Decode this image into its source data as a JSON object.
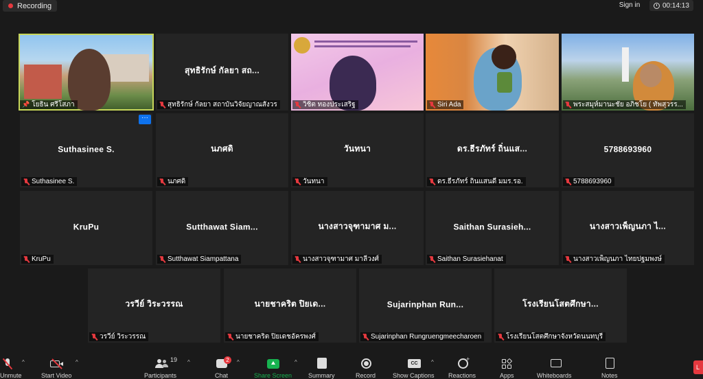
{
  "topbar": {
    "recording_label": "Recording",
    "signin_label": "Sign in",
    "timer": "00:14:13"
  },
  "tiles": [
    {
      "center": "",
      "label": "โยธิน ศรีโสภา"
    },
    {
      "center": "สุทธิรักษ์ กัลยา สถ...",
      "label": "สุทธิรักษ์ กัลยา สถาบันวิจัยญาณสังวร"
    },
    {
      "center": "",
      "label": "วิชิต ทองประเสริฐ"
    },
    {
      "center": "",
      "label": "Siri Ada"
    },
    {
      "center": "",
      "label": "พระสมุห์มานะชัย อภิชโย ( ทัพสุวรร..."
    },
    {
      "center": "Suthasinee S.",
      "label": "Suthasinee S."
    },
    {
      "center": "นภศดิ",
      "label": "นภศดิ"
    },
    {
      "center": "วันทนา",
      "label": "วันทนา"
    },
    {
      "center": "ดร.ธีรภัทร์ ถิ่นแส...",
      "label": "ดร.ธีรภัทร์ ถิ่นแสนดี มมร.รอ."
    },
    {
      "center": "5788693960",
      "label": "5788693960"
    },
    {
      "center": "KruPu",
      "label": "KruPu"
    },
    {
      "center": "Sutthawat  Siam...",
      "label": "Sutthawat Siampattana"
    },
    {
      "center": "นางสาวจุฑามาศ ม...",
      "label": "นางสาวจุฑามาศ มาลีวงศ์"
    },
    {
      "center": "Saithan  Surasieh...",
      "label": "Saithan Surasiehanat"
    },
    {
      "center": "นางสาวเพ็ญนภา ไ...",
      "label": "นางสาวเพ็ญนภา ไทยปฐมพงษ์"
    },
    {
      "center": "วรวีย์ วิระวรรณ",
      "label": "วรวีย์ วิระวรรณ"
    },
    {
      "center": "นายชาคริต  ปิยเด...",
      "label": "นายชาคริต ปิยเดชอัครพงศ์"
    },
    {
      "center": "Sujarinphan  Run...",
      "label": "Sujarinphan Rungruengmeecharoen"
    },
    {
      "center": "โรงเรียนโสตศึกษา...",
      "label": "โรงเรียนโสตศึกษาจังหวัดนนทบุรี"
    }
  ],
  "more_button": "···",
  "toolbar": {
    "unmute": "Unmute",
    "start_video": "Start Video",
    "participants": "Participants",
    "participants_count": "19",
    "chat": "Chat",
    "chat_badge": "2",
    "share_screen": "Share Screen",
    "summary": "Summary",
    "record": "Record",
    "show_captions": "Show Captions",
    "captions_icon_text": "CC",
    "reactions": "Reactions",
    "apps": "Apps",
    "whiteboards": "Whiteboards",
    "notes": "Notes",
    "end": "L"
  },
  "colors": {
    "background": "#1a1a1a",
    "tile": "#242424",
    "active_speaker": "#c7d65a",
    "share_green": "#17b350",
    "accent_blue": "#0e72ed",
    "muted_red": "#e5393f"
  }
}
